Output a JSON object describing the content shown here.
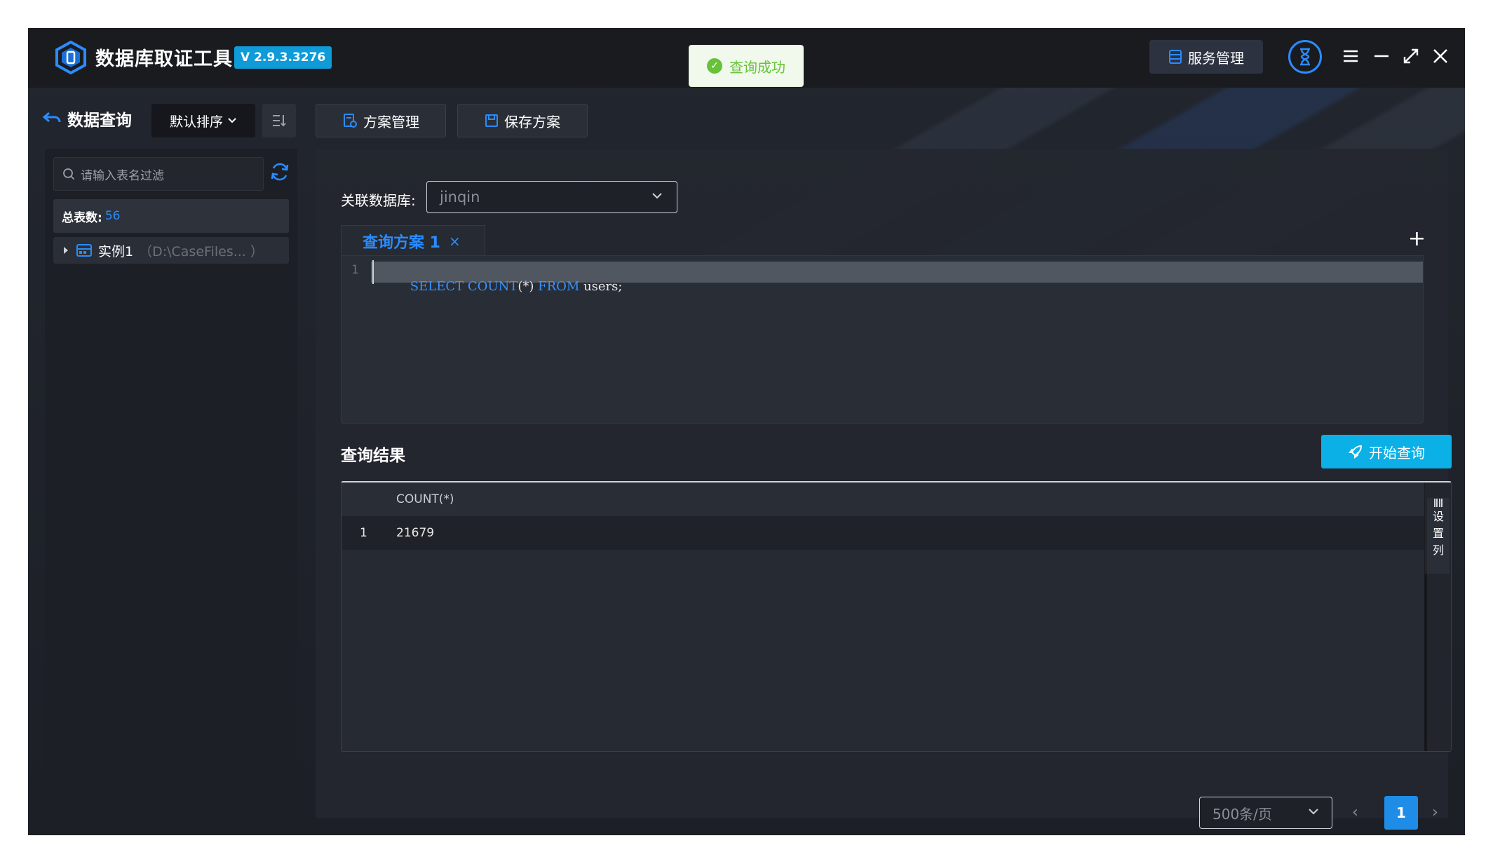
{
  "app": {
    "title": "数据库取证工具",
    "version": "V 2.9.3.3276"
  },
  "toast": {
    "message": "查询成功"
  },
  "header": {
    "service_label": "服务管理"
  },
  "toolbar": {
    "back_label": "数据查询",
    "sort_label": "默认排序",
    "plan_manage_label": "方案管理",
    "save_plan_label": "保存方案"
  },
  "sidebar": {
    "search_placeholder": "请输入表名过滤",
    "total_label": "总表数:",
    "total_value": "56",
    "tree": [
      {
        "name": "实例1",
        "path": "（D:\\CaseFiles... ）"
      }
    ]
  },
  "main": {
    "db_label": "关联数据库:",
    "db_value": "jinqin",
    "tab_label": "查询方案 1",
    "tab_close": "×",
    "tab_add": "+",
    "editor": {
      "line_number": "1",
      "tokens": [
        {
          "text": "SELECT",
          "kind": "kw"
        },
        {
          "text": " ",
          "kind": "op"
        },
        {
          "text": "COUNT",
          "kind": "kw"
        },
        {
          "text": "(*)",
          "kind": "op"
        },
        {
          "text": " ",
          "kind": "op"
        },
        {
          "text": "FROM",
          "kind": "kw"
        },
        {
          "text": " users;",
          "kind": "id"
        }
      ]
    },
    "result_title": "查询结果",
    "start_label": "开始查询",
    "columns": [
      "COUNT(*)"
    ],
    "rows": [
      {
        "index": "1",
        "values": [
          "21679"
        ]
      }
    ],
    "column_settings": [
      "设",
      "置",
      "列"
    ]
  },
  "pagination": {
    "page_size": "500条/页",
    "prev": "‹",
    "current_page": "1",
    "next": "›"
  },
  "colors": {
    "accent": "#2a8cff",
    "start_button": "#0ab0e6",
    "success": "#67c23a",
    "version_badge": "#0f9ad8"
  }
}
